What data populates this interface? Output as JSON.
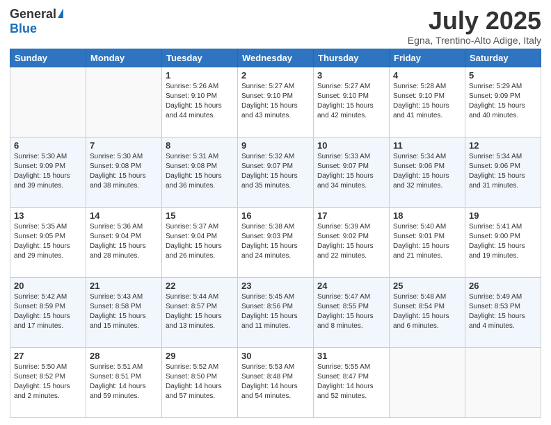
{
  "logo": {
    "general": "General",
    "blue": "Blue"
  },
  "header": {
    "month": "July 2025",
    "location": "Egna, Trentino-Alto Adige, Italy"
  },
  "weekdays": [
    "Sunday",
    "Monday",
    "Tuesday",
    "Wednesday",
    "Thursday",
    "Friday",
    "Saturday"
  ],
  "weeks": [
    [
      {
        "day": "",
        "sunrise": "",
        "sunset": "",
        "daylight": ""
      },
      {
        "day": "",
        "sunrise": "",
        "sunset": "",
        "daylight": ""
      },
      {
        "day": "1",
        "sunrise": "Sunrise: 5:26 AM",
        "sunset": "Sunset: 9:10 PM",
        "daylight": "Daylight: 15 hours and 44 minutes."
      },
      {
        "day": "2",
        "sunrise": "Sunrise: 5:27 AM",
        "sunset": "Sunset: 9:10 PM",
        "daylight": "Daylight: 15 hours and 43 minutes."
      },
      {
        "day": "3",
        "sunrise": "Sunrise: 5:27 AM",
        "sunset": "Sunset: 9:10 PM",
        "daylight": "Daylight: 15 hours and 42 minutes."
      },
      {
        "day": "4",
        "sunrise": "Sunrise: 5:28 AM",
        "sunset": "Sunset: 9:10 PM",
        "daylight": "Daylight: 15 hours and 41 minutes."
      },
      {
        "day": "5",
        "sunrise": "Sunrise: 5:29 AM",
        "sunset": "Sunset: 9:09 PM",
        "daylight": "Daylight: 15 hours and 40 minutes."
      }
    ],
    [
      {
        "day": "6",
        "sunrise": "Sunrise: 5:30 AM",
        "sunset": "Sunset: 9:09 PM",
        "daylight": "Daylight: 15 hours and 39 minutes."
      },
      {
        "day": "7",
        "sunrise": "Sunrise: 5:30 AM",
        "sunset": "Sunset: 9:08 PM",
        "daylight": "Daylight: 15 hours and 38 minutes."
      },
      {
        "day": "8",
        "sunrise": "Sunrise: 5:31 AM",
        "sunset": "Sunset: 9:08 PM",
        "daylight": "Daylight: 15 hours and 36 minutes."
      },
      {
        "day": "9",
        "sunrise": "Sunrise: 5:32 AM",
        "sunset": "Sunset: 9:07 PM",
        "daylight": "Daylight: 15 hours and 35 minutes."
      },
      {
        "day": "10",
        "sunrise": "Sunrise: 5:33 AM",
        "sunset": "Sunset: 9:07 PM",
        "daylight": "Daylight: 15 hours and 34 minutes."
      },
      {
        "day": "11",
        "sunrise": "Sunrise: 5:34 AM",
        "sunset": "Sunset: 9:06 PM",
        "daylight": "Daylight: 15 hours and 32 minutes."
      },
      {
        "day": "12",
        "sunrise": "Sunrise: 5:34 AM",
        "sunset": "Sunset: 9:06 PM",
        "daylight": "Daylight: 15 hours and 31 minutes."
      }
    ],
    [
      {
        "day": "13",
        "sunrise": "Sunrise: 5:35 AM",
        "sunset": "Sunset: 9:05 PM",
        "daylight": "Daylight: 15 hours and 29 minutes."
      },
      {
        "day": "14",
        "sunrise": "Sunrise: 5:36 AM",
        "sunset": "Sunset: 9:04 PM",
        "daylight": "Daylight: 15 hours and 28 minutes."
      },
      {
        "day": "15",
        "sunrise": "Sunrise: 5:37 AM",
        "sunset": "Sunset: 9:04 PM",
        "daylight": "Daylight: 15 hours and 26 minutes."
      },
      {
        "day": "16",
        "sunrise": "Sunrise: 5:38 AM",
        "sunset": "Sunset: 9:03 PM",
        "daylight": "Daylight: 15 hours and 24 minutes."
      },
      {
        "day": "17",
        "sunrise": "Sunrise: 5:39 AM",
        "sunset": "Sunset: 9:02 PM",
        "daylight": "Daylight: 15 hours and 22 minutes."
      },
      {
        "day": "18",
        "sunrise": "Sunrise: 5:40 AM",
        "sunset": "Sunset: 9:01 PM",
        "daylight": "Daylight: 15 hours and 21 minutes."
      },
      {
        "day": "19",
        "sunrise": "Sunrise: 5:41 AM",
        "sunset": "Sunset: 9:00 PM",
        "daylight": "Daylight: 15 hours and 19 minutes."
      }
    ],
    [
      {
        "day": "20",
        "sunrise": "Sunrise: 5:42 AM",
        "sunset": "Sunset: 8:59 PM",
        "daylight": "Daylight: 15 hours and 17 minutes."
      },
      {
        "day": "21",
        "sunrise": "Sunrise: 5:43 AM",
        "sunset": "Sunset: 8:58 PM",
        "daylight": "Daylight: 15 hours and 15 minutes."
      },
      {
        "day": "22",
        "sunrise": "Sunrise: 5:44 AM",
        "sunset": "Sunset: 8:57 PM",
        "daylight": "Daylight: 15 hours and 13 minutes."
      },
      {
        "day": "23",
        "sunrise": "Sunrise: 5:45 AM",
        "sunset": "Sunset: 8:56 PM",
        "daylight": "Daylight: 15 hours and 11 minutes."
      },
      {
        "day": "24",
        "sunrise": "Sunrise: 5:47 AM",
        "sunset": "Sunset: 8:55 PM",
        "daylight": "Daylight: 15 hours and 8 minutes."
      },
      {
        "day": "25",
        "sunrise": "Sunrise: 5:48 AM",
        "sunset": "Sunset: 8:54 PM",
        "daylight": "Daylight: 15 hours and 6 minutes."
      },
      {
        "day": "26",
        "sunrise": "Sunrise: 5:49 AM",
        "sunset": "Sunset: 8:53 PM",
        "daylight": "Daylight: 15 hours and 4 minutes."
      }
    ],
    [
      {
        "day": "27",
        "sunrise": "Sunrise: 5:50 AM",
        "sunset": "Sunset: 8:52 PM",
        "daylight": "Daylight: 15 hours and 2 minutes."
      },
      {
        "day": "28",
        "sunrise": "Sunrise: 5:51 AM",
        "sunset": "Sunset: 8:51 PM",
        "daylight": "Daylight: 14 hours and 59 minutes."
      },
      {
        "day": "29",
        "sunrise": "Sunrise: 5:52 AM",
        "sunset": "Sunset: 8:50 PM",
        "daylight": "Daylight: 14 hours and 57 minutes."
      },
      {
        "day": "30",
        "sunrise": "Sunrise: 5:53 AM",
        "sunset": "Sunset: 8:48 PM",
        "daylight": "Daylight: 14 hours and 54 minutes."
      },
      {
        "day": "31",
        "sunrise": "Sunrise: 5:55 AM",
        "sunset": "Sunset: 8:47 PM",
        "daylight": "Daylight: 14 hours and 52 minutes."
      },
      {
        "day": "",
        "sunrise": "",
        "sunset": "",
        "daylight": ""
      },
      {
        "day": "",
        "sunrise": "",
        "sunset": "",
        "daylight": ""
      }
    ]
  ]
}
